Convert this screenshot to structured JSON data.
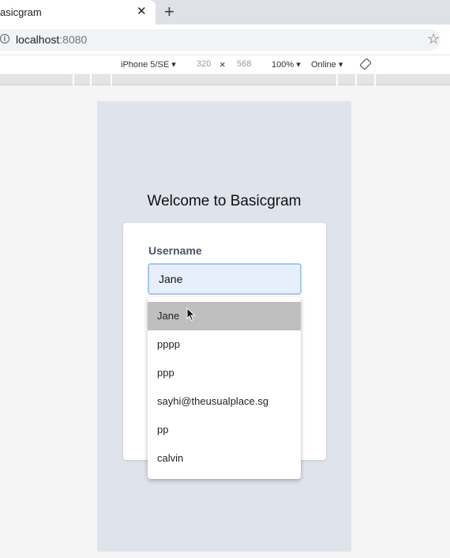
{
  "browser": {
    "tab_title": "asicgram",
    "tab_close": "✕",
    "new_tab": "+",
    "url_host": "localhost",
    "url_port": ":8080",
    "info_glyph": "i",
    "star_glyph": "☆"
  },
  "device_toolbar": {
    "device": "iPhone 5/SE ▾",
    "width": "320",
    "times": "×",
    "height": "568",
    "zoom": "100% ▾",
    "network": "Online ▾"
  },
  "page": {
    "welcome": "Welcome to Basicgram",
    "username_label": "Username",
    "username_value": "Jane"
  },
  "autofill": {
    "items": [
      {
        "label": "Jane"
      },
      {
        "label": "pppp"
      },
      {
        "label": "ppp"
      },
      {
        "label": "sayhi@theusualplace.sg"
      },
      {
        "label": "pp"
      },
      {
        "label": "calvin"
      }
    ]
  },
  "colors": {
    "viewport_bg": "#dfe3ec",
    "input_bg": "#e7effd",
    "input_border": "#a4c8f0",
    "dropdown_highlight": "#bfbfbf"
  },
  "icons": [
    "close-icon",
    "plus-icon",
    "info-icon",
    "star-icon",
    "rotate-icon",
    "cursor-icon"
  ]
}
